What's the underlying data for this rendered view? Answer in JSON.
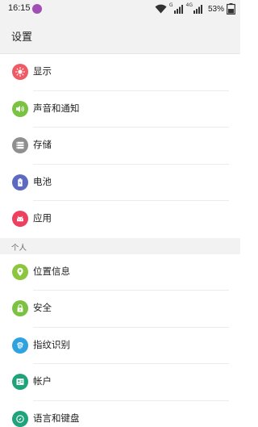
{
  "status_bar": {
    "time": "16:15",
    "sim1_label": "G",
    "sim2_label": "4G",
    "battery_percent": "53%"
  },
  "header": {
    "title": "设置"
  },
  "device_items": [
    {
      "label": "显示",
      "icon": "brightness-icon",
      "color": "#f05a64"
    },
    {
      "label": "声音和通知",
      "icon": "volume-icon",
      "color": "#7cc242"
    },
    {
      "label": "存储",
      "icon": "storage-icon",
      "color": "#8f8f8f"
    },
    {
      "label": "电池",
      "icon": "battery-icon",
      "color": "#5c6bc0"
    },
    {
      "label": "应用",
      "icon": "android-icon",
      "color": "#ef3f5f"
    }
  ],
  "personal_section": {
    "title": "个人"
  },
  "personal_items": [
    {
      "label": "位置信息",
      "icon": "location-icon",
      "color": "#8cc63f"
    },
    {
      "label": "安全",
      "icon": "lock-icon",
      "color": "#7cc242"
    },
    {
      "label": "指纹识别",
      "icon": "fingerprint-icon",
      "color": "#2ea3e0"
    },
    {
      "label": "帐户",
      "icon": "account-icon",
      "color": "#1ea37a"
    },
    {
      "label": "语言和键盘",
      "icon": "language-icon",
      "color": "#1ea37a"
    }
  ]
}
